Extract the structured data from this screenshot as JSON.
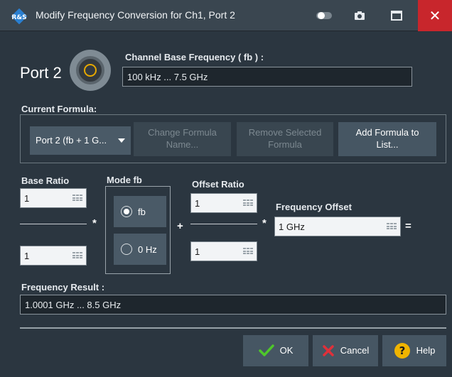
{
  "window": {
    "title": "Modify Frequency Conversion for Ch1, Port 2",
    "close_label": "✕"
  },
  "port": {
    "title": "Port 2"
  },
  "channel_base": {
    "label": "Channel Base Frequency ( fb ) :",
    "value": "100 kHz ... 7.5 GHz"
  },
  "current_formula": {
    "label": "Current Formula:",
    "selected": "Port 2 (fb + 1 G...",
    "buttons": {
      "change_name": "Change Formula Name...",
      "remove_selected": "Remove Selected Formula",
      "add_to_list": "Add Formula to List..."
    }
  },
  "base_ratio": {
    "label": "Base Ratio",
    "numerator": "1",
    "denominator": "1"
  },
  "mode_fb": {
    "label": "Mode  fb",
    "options": [
      {
        "label": "fb",
        "selected": true
      },
      {
        "label": "0 Hz",
        "selected": false
      }
    ]
  },
  "offset_ratio": {
    "label": "Offset Ratio",
    "numerator": "1",
    "denominator": "1"
  },
  "frequency_offset": {
    "label": "Frequency Offset",
    "value": "1 GHz"
  },
  "operators": {
    "multiply": "*",
    "plus": "+",
    "equals": "="
  },
  "frequency_result": {
    "label": "Frequency Result :",
    "value": "1.0001 GHz ... 8.5 GHz"
  },
  "footer": {
    "ok": "OK",
    "cancel": "Cancel",
    "help": "Help"
  },
  "colors": {
    "background": "#2b3640",
    "title_bar": "#3a4650",
    "close_button": "#c8262c",
    "ok_check": "#4ec72a",
    "cancel_x": "#e0303a",
    "help_circle": "#f0b400",
    "port_connector_accent": "#e6a800"
  },
  "icons": {
    "app": "rohde-schwarz-logo-icon",
    "toggle": "toggle-icon",
    "camera": "camera-icon",
    "maximize": "maximize-icon",
    "close": "close-icon",
    "ok": "checkmark-icon",
    "cancel": "x-icon",
    "help": "question-icon",
    "dropdown": "caret-down-icon",
    "keypad": "keypad-icon"
  }
}
